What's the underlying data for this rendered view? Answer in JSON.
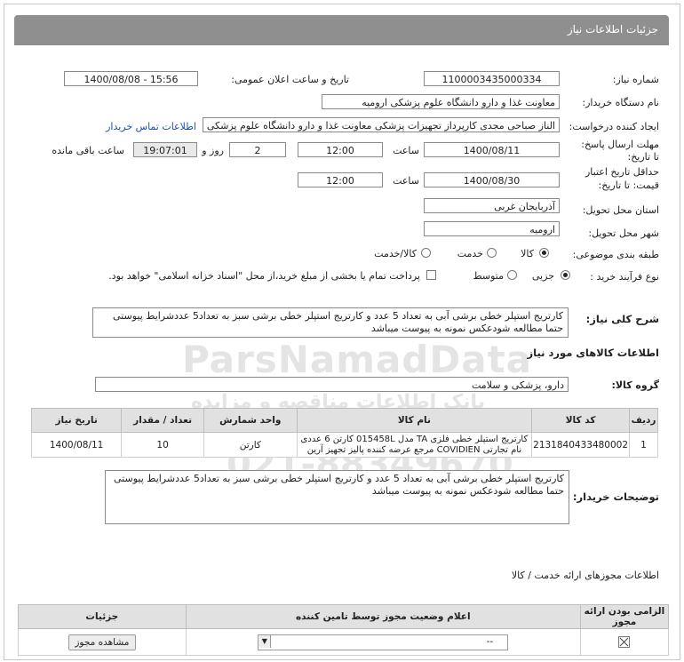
{
  "header": {
    "title": "جزئیات اطلاعات نیاز"
  },
  "fields": {
    "need_number_label": "شماره نیاز:",
    "need_number": "1100003435000334",
    "announce_label": "تاریخ و ساعت اعلان عمومی:",
    "announce_value": "1400/08/08 - 15:56",
    "buyer_org_label": "نام دستگاه خریدار:",
    "buyer_org": "معاونت غذا و دارو دانشگاه علوم پزشکی ارومیه",
    "requester_label": "ایجاد کننده درخواست:",
    "requester": "الناز صباحی مجدی کارپرداز تجهیزات پزشکی معاونت غذا و دارو دانشگاه علوم پزشکی ارومیه",
    "contact_link": "اطلاعات تماس خریدار",
    "reply_deadline_label": "مهلت ارسال پاسخ: تا تاریخ:",
    "reply_date": "1400/08/11",
    "time_label": "ساعت",
    "reply_time": "12:00",
    "day_label": "روز و",
    "days": "2",
    "remaining_time": "19:07:01",
    "remaining_label": "ساعت باقی مانده",
    "validity_label_1": "حداقل تاریخ اعتبار",
    "validity_label_2": "قیمت: تا تاریخ:",
    "validity_date": "1400/08/30",
    "validity_time": "12:00",
    "province_label": "استان محل تحویل:",
    "province": "آذربایجان غربی",
    "city_label": "شهر محل تحویل:",
    "city": "ارومیه",
    "category_label": "طبقه بندی موضوعی:",
    "cat_goods": "کالا",
    "cat_service": "خدمت",
    "cat_goods_service": "کالا/خدمت",
    "process_label": "نوع فرآیند خرید :",
    "proc_partial": "جزیی",
    "proc_medium": "متوسط",
    "proc_note": "پرداخت تمام یا بخشی از مبلغ خرید،از محل \"اسناد خزانه اسلامی\" خواهد بود."
  },
  "description": {
    "label": "شرح کلی نیاز:",
    "text": "کارتریج استپلر خطی برشی آبی به تعداد 5 عدد و کارتریج استپلر خطی برشی سبز به تعداد5 عددشرایط پیوستی حتما مطالعه شودعکس نمونه به پیوست میباشد"
  },
  "goods": {
    "section_title": "اطلاعات کالاهای مورد نیاز",
    "group_label": "گروه کالا:",
    "group_value": "دارو، پزشکی و سلامت",
    "columns": [
      "ردیف",
      "کد کالا",
      "نام کالا",
      "واحد شمارش",
      "تعداد / مقدار",
      "تاریخ نیاز"
    ],
    "rows": [
      {
        "index": "1",
        "code": "2131840433480002",
        "name_line1": "کارتریج استپلر خطی فلزی TA مدل 015458L کارتن 6 عددی",
        "name_line2": "نام تجارتی COVIDIEN مرجع عرضه کننده پالیز تجهیز آرین",
        "unit": "کارتن",
        "qty": "10",
        "date": "1400/08/11"
      }
    ]
  },
  "buyer_notes": {
    "label": "توضیحات خریدار:",
    "text": "کارتریج استپلر خطی برشی آبی به تعداد 5 عدد و کارتریج استپلر خطی برشی سبز به تعداد5 عددشرایط پیوستی حتما مطالعه شودعکس نمونه به پیوست میباشد"
  },
  "permits": {
    "section_title": "اطلاعات مجوزهای ارائه خدمت / کالا",
    "columns": [
      "الزامی بودن ارائه مجوز",
      "اعلام وضعیت مجوز توسط تامین کننده",
      "جزئیات"
    ],
    "row_status": "--",
    "view_button": "مشاهده مجوز"
  },
  "watermark": {
    "brand": "ParsNamadData",
    "tagline": "بانک اطلاعات مناقصه و مزایده",
    "tagline2": "پارس نماد داده ها",
    "phone": "021-88349670"
  },
  "colors": {
    "header": "#8f8f8f",
    "link": "#1a4fb4",
    "table_header": "#e1e1e1"
  }
}
